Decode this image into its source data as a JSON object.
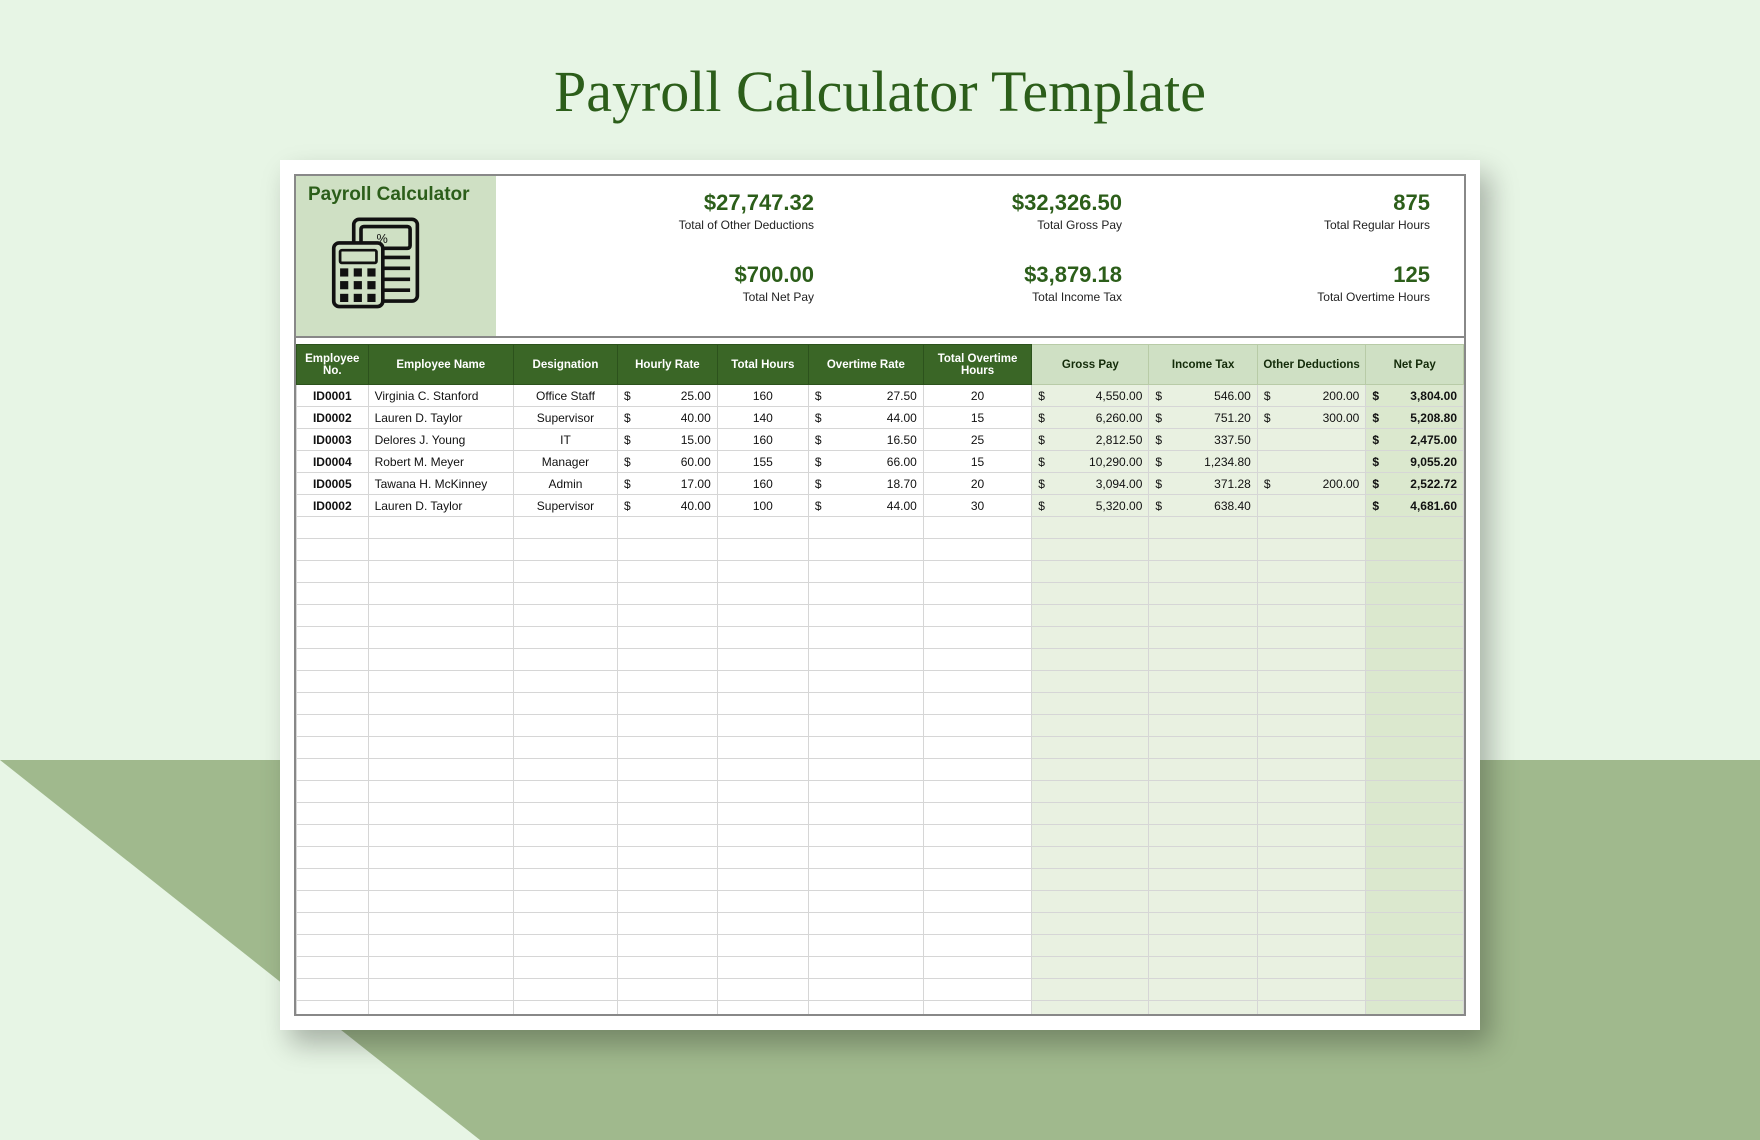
{
  "title": "Payroll Calculator Template",
  "badge": {
    "title": "Payroll Calculator"
  },
  "metrics": {
    "total_other_deductions": {
      "value": "$27,747.32",
      "label": "Total of Other Deductions"
    },
    "total_gross_pay": {
      "value": "$32,326.50",
      "label": "Total Gross Pay"
    },
    "total_regular_hours": {
      "value": "875",
      "label": "Total Regular Hours"
    },
    "total_net_pay": {
      "value": "$700.00",
      "label": "Total Net Pay"
    },
    "total_income_tax": {
      "value": "$3,879.18",
      "label": "Total Income Tax"
    },
    "total_overtime_hours": {
      "value": "125",
      "label": "Total Overtime Hours"
    }
  },
  "columns": {
    "employee_no": "Employee No.",
    "employee_name": "Employee Name",
    "designation": "Designation",
    "hourly_rate": "Hourly Rate",
    "total_hours": "Total Hours",
    "overtime_rate": "Overtime Rate",
    "total_ot_hours": "Total Overtime Hours",
    "gross_pay": "Gross Pay",
    "income_tax": "Income Tax",
    "other_ded": "Other Deductions",
    "net_pay": "Net Pay"
  },
  "rows": [
    {
      "id": "ID0001",
      "name": "Virginia C. Stanford",
      "desg": "Office Staff",
      "rate": "25.00",
      "hours": "160",
      "orate": "27.50",
      "ohours": "20",
      "gross": "4,550.00",
      "tax": "546.00",
      "ded": "200.00",
      "net": "3,804.00"
    },
    {
      "id": "ID0002",
      "name": "Lauren D. Taylor",
      "desg": "Supervisor",
      "rate": "40.00",
      "hours": "140",
      "orate": "44.00",
      "ohours": "15",
      "gross": "6,260.00",
      "tax": "751.20",
      "ded": "300.00",
      "net": "5,208.80"
    },
    {
      "id": "ID0003",
      "name": "Delores J. Young",
      "desg": "IT",
      "rate": "15.00",
      "hours": "160",
      "orate": "16.50",
      "ohours": "25",
      "gross": "2,812.50",
      "tax": "337.50",
      "ded": "",
      "net": "2,475.00"
    },
    {
      "id": "ID0004",
      "name": "Robert M. Meyer",
      "desg": "Manager",
      "rate": "60.00",
      "hours": "155",
      "orate": "66.00",
      "ohours": "15",
      "gross": "10,290.00",
      "tax": "1,234.80",
      "ded": "",
      "net": "9,055.20"
    },
    {
      "id": "ID0005",
      "name": "Tawana H. McKinney",
      "desg": "Admin",
      "rate": "17.00",
      "hours": "160",
      "orate": "18.70",
      "ohours": "20",
      "gross": "3,094.00",
      "tax": "371.28",
      "ded": "200.00",
      "net": "2,522.72"
    },
    {
      "id": "ID0002",
      "name": "Lauren D. Taylor",
      "desg": "Supervisor",
      "rate": "40.00",
      "hours": "100",
      "orate": "44.00",
      "ohours": "30",
      "gross": "5,320.00",
      "tax": "638.40",
      "ded": "",
      "net": "4,681.60"
    }
  ],
  "currency": "$",
  "empty_rows": 23,
  "chart_data": {
    "type": "table",
    "title": "Payroll Calculator",
    "columns": [
      "Employee No.",
      "Employee Name",
      "Designation",
      "Hourly Rate",
      "Total Hours",
      "Overtime Rate",
      "Total Overtime Hours",
      "Gross Pay",
      "Income Tax",
      "Other Deductions",
      "Net Pay"
    ],
    "rows": [
      [
        "ID0001",
        "Virginia C. Stanford",
        "Office Staff",
        25.0,
        160,
        27.5,
        20,
        4550.0,
        546.0,
        200.0,
        3804.0
      ],
      [
        "ID0002",
        "Lauren D. Taylor",
        "Supervisor",
        40.0,
        140,
        44.0,
        15,
        6260.0,
        751.2,
        300.0,
        5208.8
      ],
      [
        "ID0003",
        "Delores J. Young",
        "IT",
        15.0,
        160,
        16.5,
        25,
        2812.5,
        337.5,
        null,
        2475.0
      ],
      [
        "ID0004",
        "Robert M. Meyer",
        "Manager",
        60.0,
        155,
        66.0,
        15,
        10290.0,
        1234.8,
        null,
        9055.2
      ],
      [
        "ID0005",
        "Tawana H. McKinney",
        "Admin",
        17.0,
        160,
        18.7,
        20,
        3094.0,
        371.28,
        200.0,
        2522.72
      ],
      [
        "ID0002",
        "Lauren D. Taylor",
        "Supervisor",
        40.0,
        100,
        44.0,
        30,
        5320.0,
        638.4,
        null,
        4681.6
      ]
    ],
    "summary": {
      "Total of Other Deductions": 27747.32,
      "Total Gross Pay": 32326.5,
      "Total Regular Hours": 875,
      "Total Net Pay": 700.0,
      "Total Income Tax": 3879.18,
      "Total Overtime Hours": 125
    }
  }
}
